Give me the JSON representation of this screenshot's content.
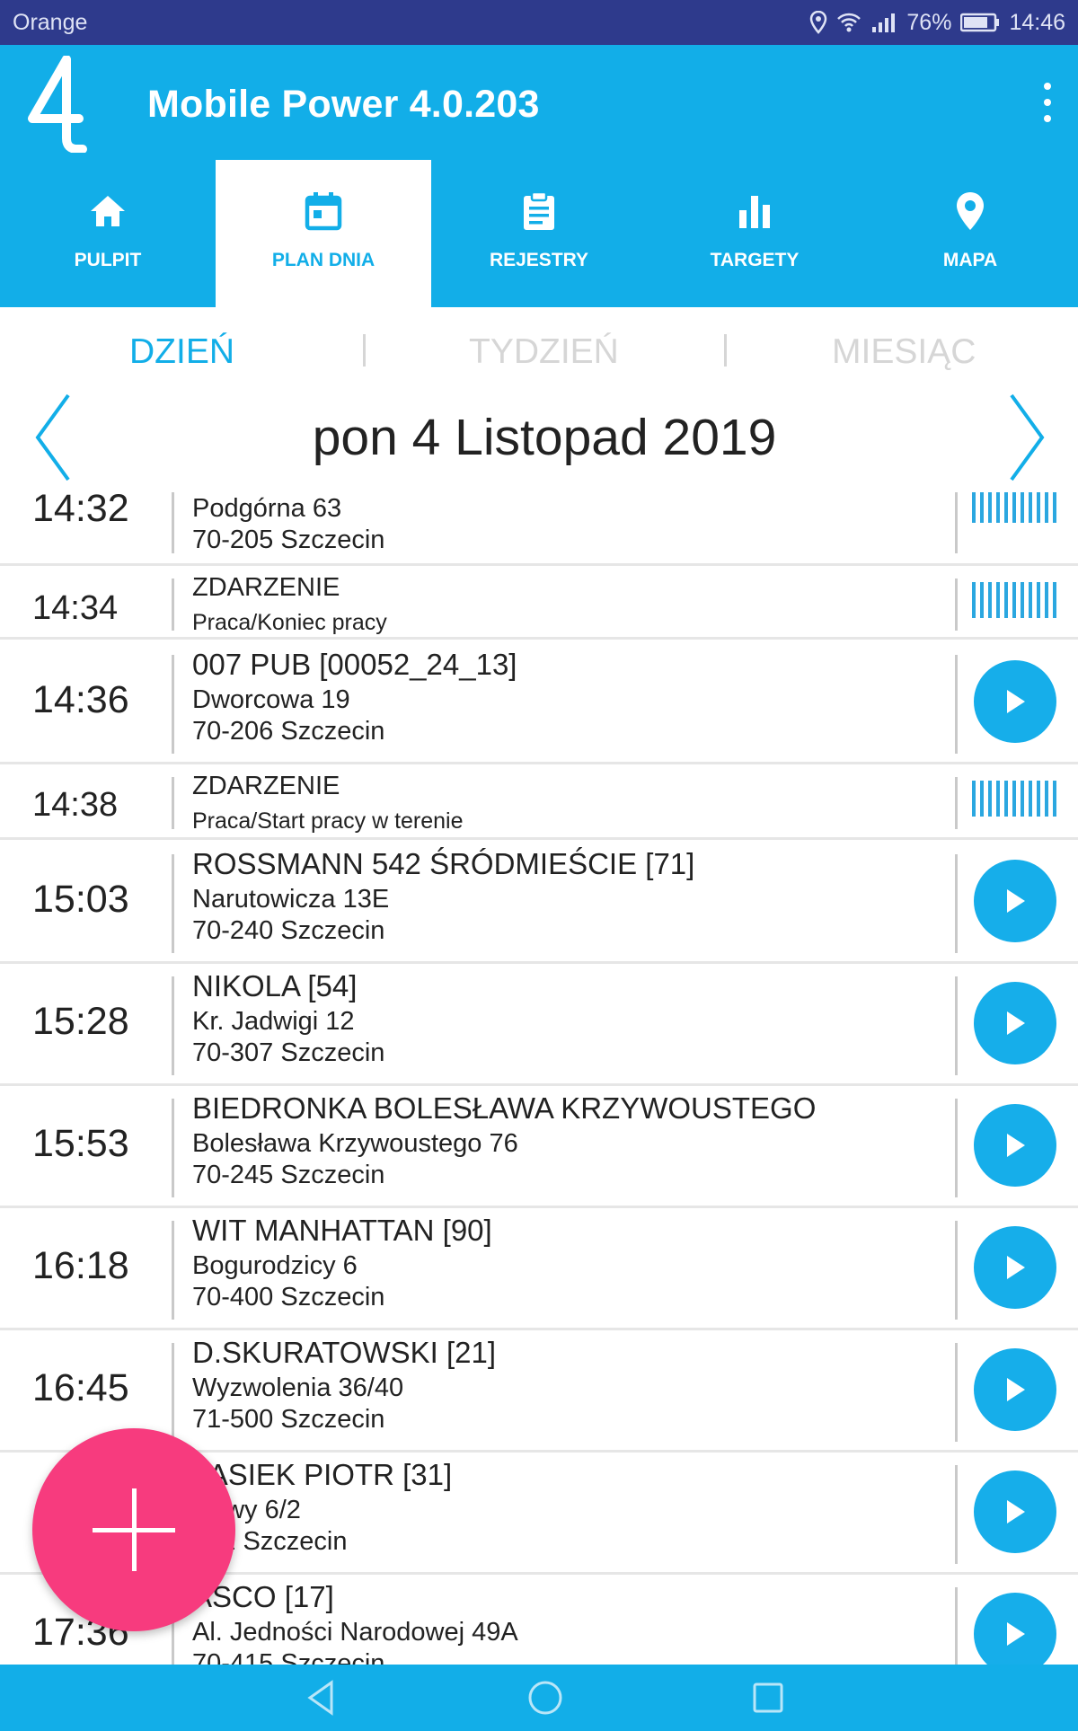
{
  "status_bar": {
    "carrier": "Orange",
    "battery": "76%",
    "time": "14:46"
  },
  "app_bar": {
    "title": "Mobile Power 4.0.203"
  },
  "tabs": [
    {
      "label": "PULPIT",
      "icon": "home-icon",
      "active": false
    },
    {
      "label": "PLAN DNIA",
      "icon": "calendar-icon",
      "active": true
    },
    {
      "label": "REJESTRY",
      "icon": "clipboard-icon",
      "active": false
    },
    {
      "label": "TARGETY",
      "icon": "bar-chart-icon",
      "active": false
    },
    {
      "label": "MAPA",
      "icon": "map-pin-icon",
      "active": false
    }
  ],
  "segment": {
    "day": "DZIEŃ",
    "week": "TYDZIEŃ",
    "month": "MIESIĄC",
    "selected": "day"
  },
  "date": {
    "title": "pon 4 Listopad 2019"
  },
  "visits": [
    {
      "time": "14:32",
      "line1": "Podgórna 63",
      "line2": "70-205 Szczecin",
      "line3": "",
      "type": "visit-done"
    },
    {
      "time": "14:34",
      "line1": "ZDARZENIE",
      "line2": "Praca/Koniec pracy",
      "line3": "",
      "type": "event"
    },
    {
      "time": "14:36",
      "line1": "007 PUB [00052_24_13]",
      "line2": "Dworcowa 19",
      "line3": "70-206 Szczecin",
      "type": "visit"
    },
    {
      "time": "14:38",
      "line1": "ZDARZENIE",
      "line2": "Praca/Start pracy w terenie",
      "line3": "",
      "type": "event"
    },
    {
      "time": "15:03",
      "line1": "ROSSMANN 542 ŚRÓDMIEŚCIE [71]",
      "line2": "Narutowicza 13E",
      "line3": "70-240 Szczecin",
      "type": "visit"
    },
    {
      "time": "15:28",
      "line1": "NIKOLA [54]",
      "line2": "Kr. Jadwigi 12",
      "line3": "70-307 Szczecin",
      "type": "visit"
    },
    {
      "time": "15:53",
      "line1": "BIEDRONKA BOLESŁAWA KRZYWOUSTEGO",
      "line2": "Bolesława Krzywoustego 76",
      "line3": "70-245 Szczecin",
      "type": "visit"
    },
    {
      "time": "16:18",
      "line1": "WIT MANHATTAN [90]",
      "line2": "Bogurodzicy 6",
      "line3": "70-400 Szczecin",
      "type": "visit"
    },
    {
      "time": "16:45",
      "line1": "D.SKURATOWSKI [21]",
      "line2": "Wyzwolenia 36/40",
      "line3": "71-500 Szczecin",
      "type": "visit"
    },
    {
      "time": "",
      "line1": "TASIEK PIOTR [31]",
      "line2": "sławy 6/2",
      "line3": "402 Szczecin",
      "type": "visit"
    },
    {
      "time": "17:36",
      "line1": "ASCO [17]",
      "line2": "Al. Jedności Narodowej 49A",
      "line3": "70-415 Szczecin",
      "type": "visit"
    }
  ],
  "fab": {
    "icon": "plus-icon"
  },
  "nav_bar": {
    "back": "back-icon",
    "home": "home-circle-icon",
    "recents": "recents-icon"
  }
}
